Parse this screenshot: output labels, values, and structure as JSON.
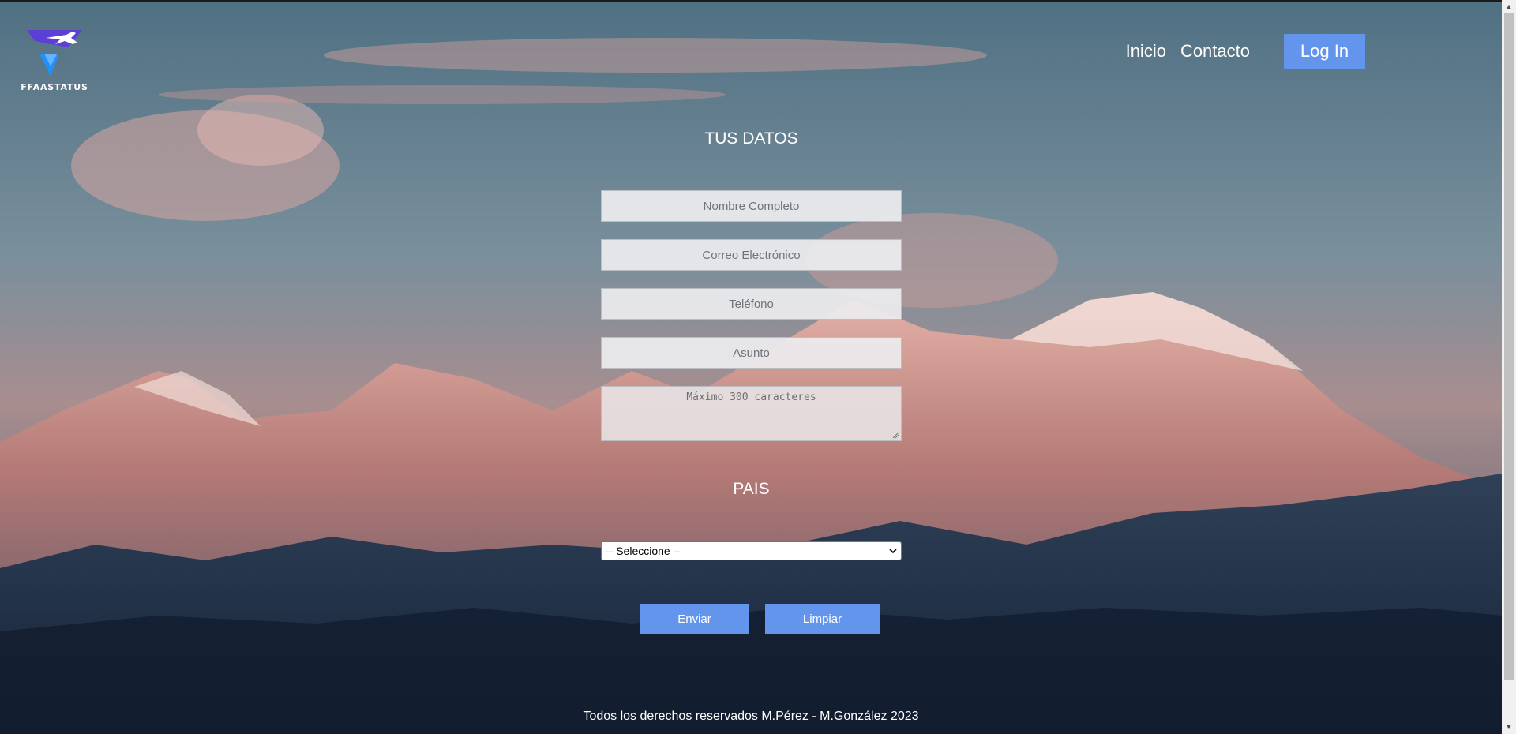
{
  "logo": {
    "text": "FFAASTATUS",
    "icon": "jet-plane-logo-icon"
  },
  "nav": {
    "links": [
      "Inicio",
      "Contacto"
    ],
    "login_label": "Log In"
  },
  "form": {
    "title": "TUS DATOS",
    "name_placeholder": "Nombre Completo",
    "email_placeholder": "Correo Electrónico",
    "phone_placeholder": "Teléfono",
    "subject_placeholder": "Asunto",
    "message_placeholder": "Máximo 300 caracteres",
    "country_title": "PAIS",
    "country_selected": "-- Seleccione --",
    "submit_label": "Enviar",
    "reset_label": "Limpiar"
  },
  "footer": {
    "text": "Todos los derechos reservados M.Pérez - M.González 2023"
  },
  "colors": {
    "accent": "#6495ed",
    "text": "#ffffff"
  }
}
